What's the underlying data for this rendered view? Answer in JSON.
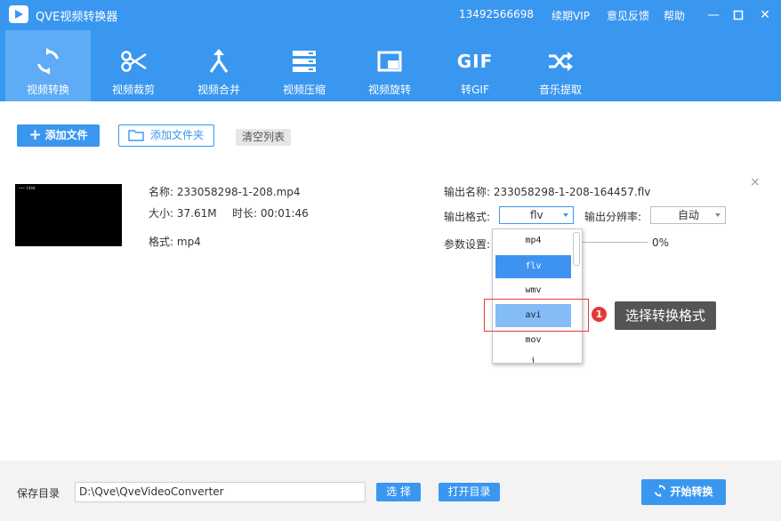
{
  "app": {
    "title": "QVE视频转换器",
    "phone": "13492566698",
    "vip": "续期VIP",
    "feedback": "意见反馈",
    "help": "帮助"
  },
  "nav": [
    {
      "label": "视频转换",
      "icon": "convert-icon"
    },
    {
      "label": "视频裁剪",
      "icon": "scissors-icon"
    },
    {
      "label": "视频合并",
      "icon": "merge-icon"
    },
    {
      "label": "视频压缩",
      "icon": "compress-icon"
    },
    {
      "label": "视频旋转",
      "icon": "rotate-icon"
    },
    {
      "label": "转GIF",
      "icon": "gif-icon",
      "icon_text": "GIF"
    },
    {
      "label": "音乐提取",
      "icon": "shuffle-icon"
    }
  ],
  "toolbar": {
    "add_file": "添加文件",
    "add_folder": "添加文件夹",
    "clear": "清空列表"
  },
  "file": {
    "thumb_text": "••• 14b8",
    "name_label": "名称:",
    "name": "233058298-1-208.mp4",
    "size_label": "大小:",
    "size": "37.61M",
    "duration_label": "时长:",
    "duration": "00:01:46",
    "format_label": "格式:",
    "format": "mp4",
    "out_name_label": "输出名称:",
    "out_name": "233058298-1-208-164457.flv",
    "out_format_label": "输出格式:",
    "out_format": "flv",
    "resolution_label": "输出分辨率:",
    "resolution": "自动",
    "params_label": "参数设置:",
    "progress": "0%"
  },
  "dropdown": {
    "options": [
      "mp4",
      "flv",
      "wmv",
      "avi",
      "mov",
      "i"
    ],
    "selected": "flv",
    "hovered": "avi"
  },
  "annotation": {
    "number": "1",
    "text": "选择转换格式"
  },
  "footer": {
    "save_label": "保存目录",
    "path": "D:\\Qve\\QveVideoConverter",
    "choose": "选 择",
    "open": "打开目录",
    "start": "开始转换"
  },
  "colors": {
    "primary": "#3a97f0",
    "active_tab": "#5eacf5",
    "selected_option": "#3e92f0",
    "hover_option": "#84bcf7",
    "annotation_red": "#e53935",
    "callout_bg": "#555555"
  }
}
